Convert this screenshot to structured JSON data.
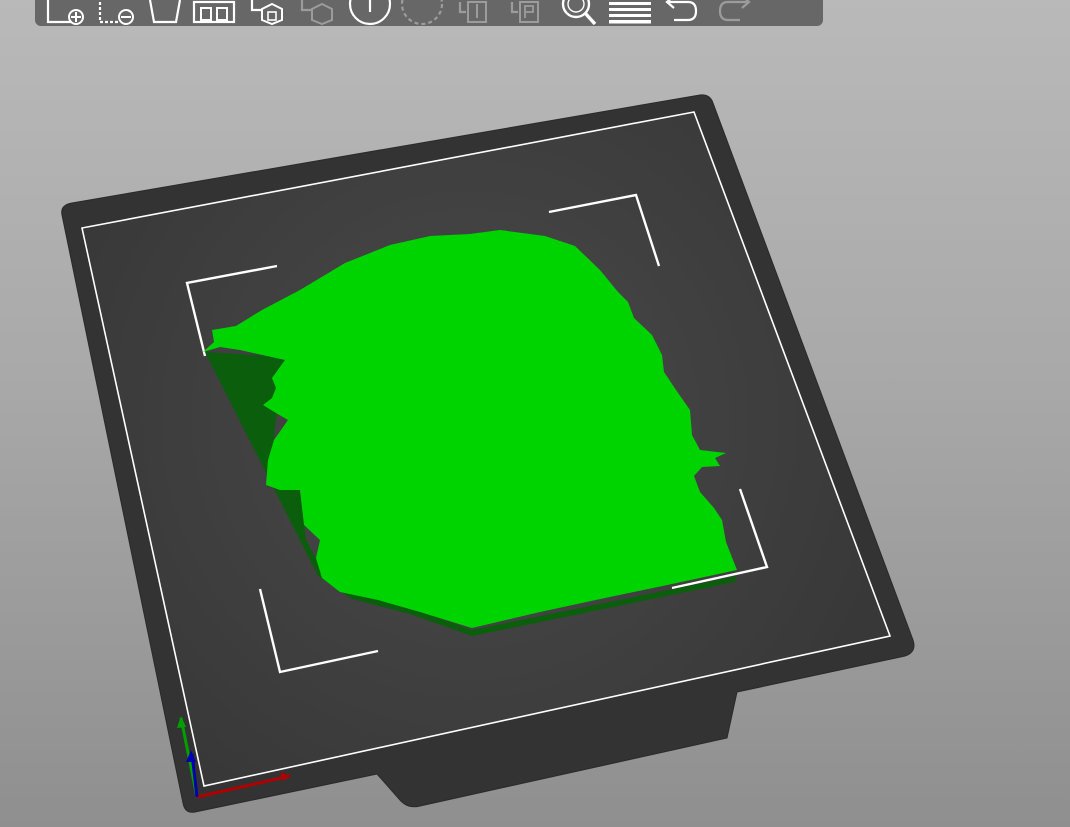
{
  "app": {
    "context": "3D plater view"
  },
  "toolbar": {
    "tools": [
      {
        "icon": "add-object-icon",
        "enabled": true
      },
      {
        "icon": "remove-object-icon",
        "enabled": true
      },
      {
        "icon": "delete-all-icon",
        "enabled": true
      },
      {
        "icon": "arrange-icon",
        "enabled": true
      },
      {
        "icon": "copy-icon",
        "enabled": true
      },
      {
        "icon": "paste-icon",
        "enabled": false
      },
      {
        "icon": "add-instance-icon",
        "enabled": true
      },
      {
        "icon": "remove-instance-icon",
        "enabled": false
      },
      {
        "icon": "split-objects-icon",
        "enabled": false
      },
      {
        "icon": "split-parts-icon",
        "enabled": false
      },
      {
        "icon": "search-icon",
        "enabled": true
      },
      {
        "icon": "layers-editing-icon",
        "enabled": true
      },
      {
        "icon": "undo-icon",
        "enabled": true
      },
      {
        "icon": "redo-icon",
        "enabled": false
      }
    ]
  },
  "scene": {
    "background_top": "#b9b9b9",
    "background_bottom": "#8f8f8f",
    "bed_color": "#353535",
    "bed_surface_color": "#3e3e3e",
    "bed_outline_color": "#ffffff",
    "model_color": "#00d400",
    "model_shadow_color": "#0a5a0a",
    "axes": {
      "x_color": "#b00000",
      "y_color": "#00a000",
      "z_color": "#0000b0"
    }
  }
}
